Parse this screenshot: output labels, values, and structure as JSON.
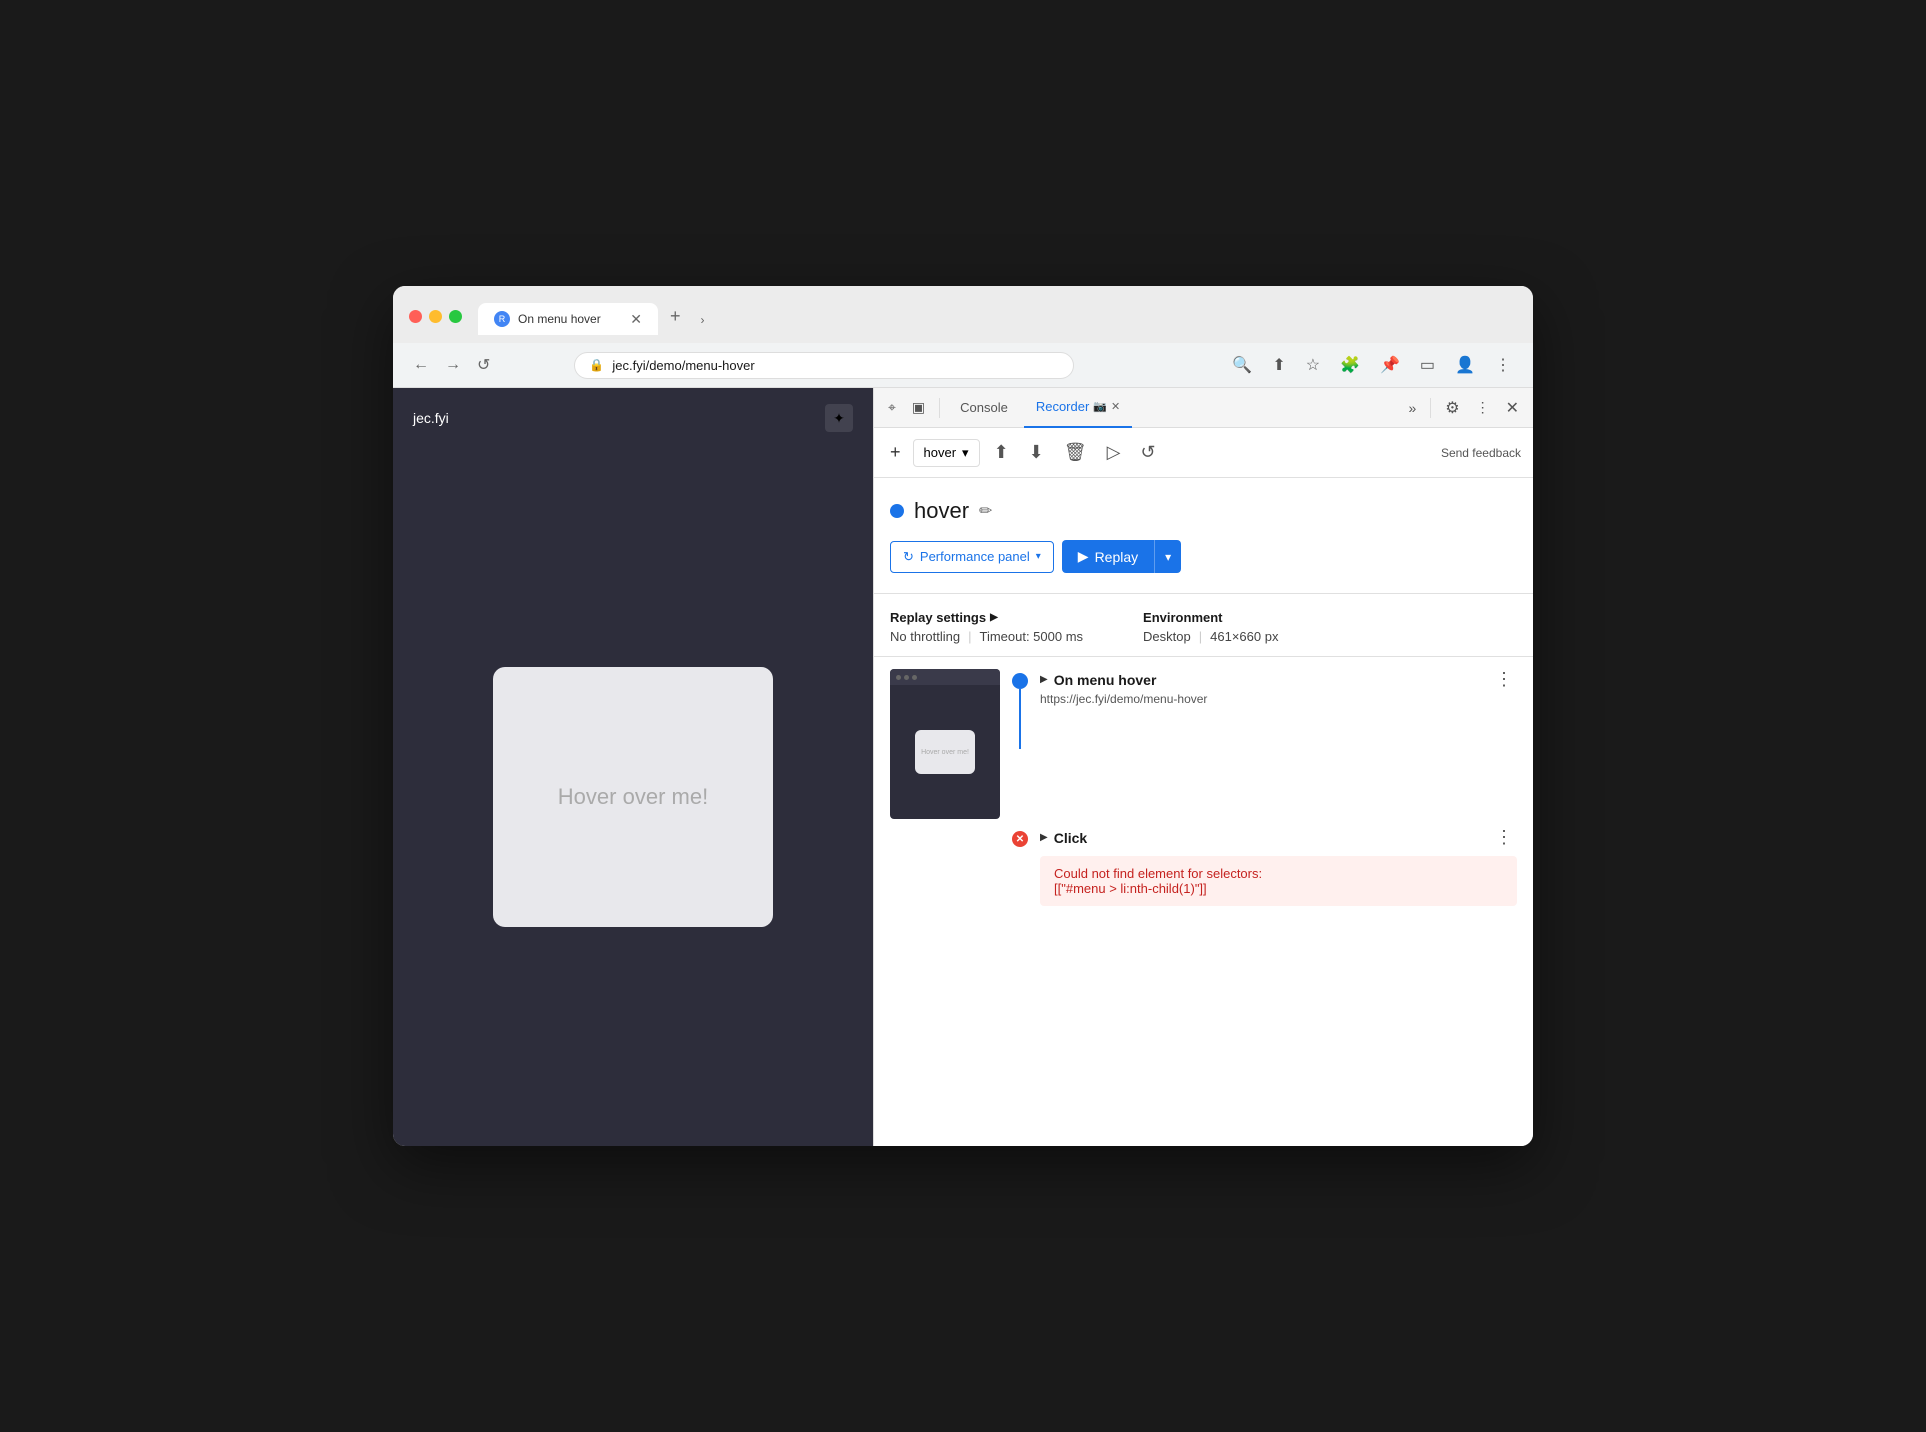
{
  "browser": {
    "tab_title": "On menu hover",
    "tab_favicon": "🔵",
    "address": "jec.fyi/demo/menu-hover",
    "address_protocol": "🔒",
    "new_tab_label": "+",
    "chevron": "›"
  },
  "devtools": {
    "tabs": [
      {
        "id": "console",
        "label": "Console"
      },
      {
        "id": "recorder",
        "label": "Recorder",
        "active": true
      }
    ],
    "more_tabs_label": "»",
    "settings_label": "⚙",
    "close_label": "✕",
    "three_dots_label": "⋮",
    "recorder_close_label": "✕",
    "recorder_dot": "📷"
  },
  "recorder_toolbar": {
    "add_label": "+",
    "select_value": "hover",
    "select_chevron": "▾",
    "upload_label": "⬆",
    "download_label": "⬇",
    "delete_label": "🗑",
    "play_label": "▷",
    "replay_menu_label": "↺",
    "send_feedback_label": "Send feedback"
  },
  "recording": {
    "dot_color": "#1a73e8",
    "name": "hover",
    "edit_icon": "✏"
  },
  "perf_panel": {
    "icon": "↻",
    "label": "Performance panel",
    "chevron": "▾"
  },
  "replay": {
    "main_label": "Replay",
    "play_icon": "▶",
    "chevron": "▾"
  },
  "replay_settings": {
    "title": "Replay settings",
    "triangle": "▶",
    "throttling_label": "No throttling",
    "timeout_label": "Timeout: 5000 ms",
    "environment_title": "Environment",
    "desktop_label": "Desktop",
    "resolution_label": "461×660 px"
  },
  "steps": [
    {
      "id": "step-navigate",
      "title": "On menu hover",
      "url": "https://jec.fyi/demo/menu-hover",
      "dot_type": "blue",
      "has_thumbnail": true,
      "thumb_text": "Hover over me!"
    },
    {
      "id": "step-click",
      "title": "Click",
      "dot_type": "red",
      "error": true,
      "error_text": "Could not find element for selectors:",
      "error_code": "[[\"#menu > li:nth-child(1)\"]]"
    }
  ],
  "page": {
    "logo": "jec.fyi",
    "sun_icon": "✦",
    "hover_text": "Hover over me!"
  },
  "icons": {
    "back": "←",
    "forward": "→",
    "refresh": "↺",
    "search": "🔍",
    "share": "⬆",
    "bookmark": "☆",
    "puzzle": "🧩",
    "pin": "📌",
    "profile": "👤",
    "more_vert": "⋮",
    "devtools_cursor": "⌖",
    "devtools_responsive": "▣",
    "shield": "🔒"
  }
}
